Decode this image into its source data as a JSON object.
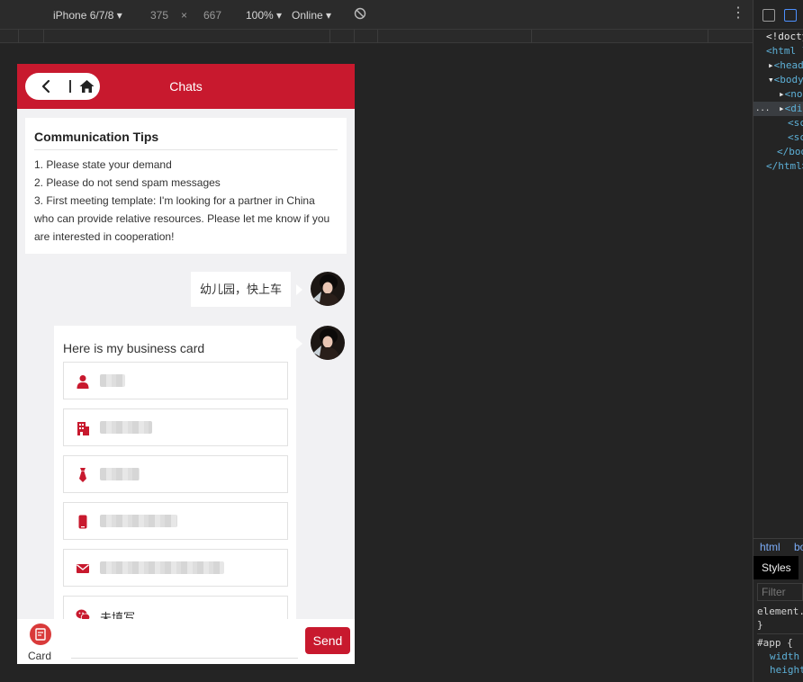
{
  "devtools_toolbar": {
    "device": "iPhone 6/7/8",
    "width": "375",
    "times": "×",
    "height": "667",
    "zoom": "100%",
    "network": "Online"
  },
  "dom_tree": {
    "rows": [
      "<!docty",
      "<html l",
      "<head",
      "<body",
      "<no",
      "<di",
      "<sc",
      "<sc",
      "</bod",
      "</html>"
    ],
    "ellipsis": "..."
  },
  "breadcrumbs": [
    "html",
    "bo"
  ],
  "styles": {
    "tab": "Styles",
    "filter_placeholder": "Filter",
    "element_line": "element.",
    "close_brace": "}",
    "rule_selector": "#app {",
    "props": [
      "width",
      "height"
    ]
  },
  "app": {
    "header_title": "Chats",
    "tips": {
      "title": "Communication Tips",
      "lines": [
        "1. Please state your demand",
        "2. Please do not send spam messages",
        "3. First meeting template: I'm looking for a partner in China",
        "who can provide relative resources. Please let me know if you",
        "are interested in cooperation!"
      ]
    },
    "message_text": "幼儿园，快上车",
    "card": {
      "heading": "Here is my business card",
      "fields": [
        {
          "icon": "person-icon",
          "blurred": true
        },
        {
          "icon": "building-icon",
          "blurred": true
        },
        {
          "icon": "tie-icon",
          "blurred": true
        },
        {
          "icon": "mobile-phone-icon",
          "blurred": true
        },
        {
          "icon": "envelope-icon",
          "blurred": true
        },
        {
          "icon": "wechat-icon",
          "value": "未填写"
        }
      ]
    },
    "bottom": {
      "card_label": "Card",
      "send_label": "Send",
      "input_placeholder": ""
    }
  },
  "colors": {
    "brand_red": "#c8192e",
    "page_bg": "#f1f1f3",
    "devtools_bg": "#242424"
  }
}
